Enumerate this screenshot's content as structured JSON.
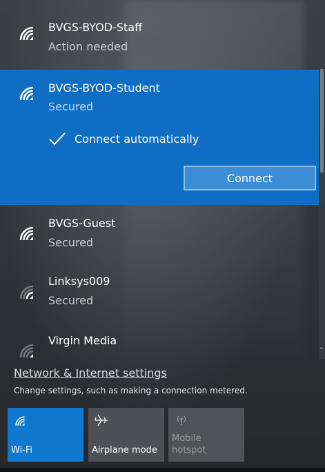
{
  "networks": [
    {
      "ssid": "BVGS-BYOD-Staff",
      "status": "Action needed"
    },
    {
      "ssid": "BVGS-BYOD-Student",
      "status": "Secured",
      "selected": true,
      "connect_automatically_label": "Connect automatically",
      "connect_automatically_checked": true,
      "connect_label": "Connect"
    },
    {
      "ssid": "BVGS-Guest",
      "status": "Secured"
    },
    {
      "ssid": "Linksys009",
      "status": "Secured"
    },
    {
      "ssid": "Virgin Media"
    }
  ],
  "settings": {
    "link_label": "Network & Internet settings",
    "description": "Change settings, such as making a connection metered."
  },
  "quick_actions": [
    {
      "label": "Wi-Fi",
      "icon": "wifi-icon",
      "active": true
    },
    {
      "label": "Airplane mode",
      "icon": "airplane-icon",
      "active": false
    },
    {
      "label": "Mobile hotspot",
      "icon": "hotspot-icon",
      "active": false,
      "disabled": true
    }
  ],
  "colors": {
    "accent": "#0f6ec4",
    "tile_active": "#1178cf",
    "tile_inactive": "#4d5156"
  }
}
